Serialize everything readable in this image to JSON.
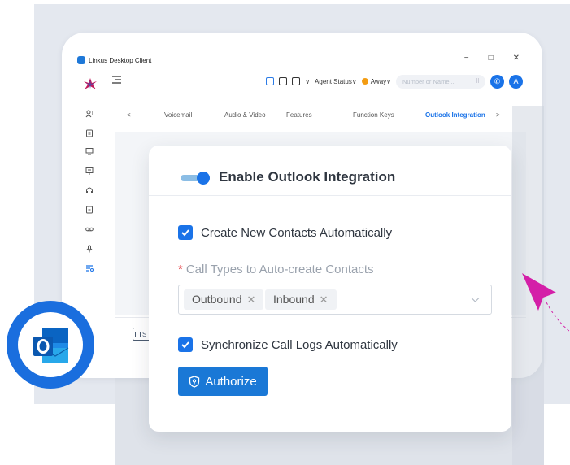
{
  "window": {
    "title": "Linkus Desktop Client",
    "controls": [
      "−",
      "□",
      "✕"
    ]
  },
  "toolbar": {
    "agent_status": "Agent Status",
    "presence": "Away",
    "search_placeholder": "Number or Name...",
    "avatar_letter": "A"
  },
  "tabs": [
    "Voicemail",
    "Audio & Video",
    "Features",
    "Function Keys",
    "Outlook Integration"
  ],
  "active_tab": "Outlook Integration",
  "save_label": "S",
  "card": {
    "title": "Enable Outlook Integration",
    "create_contacts_label": "Create New Contacts Automatically",
    "call_types_label": "Call Types to Auto-create Contacts",
    "required_mark": "*",
    "chips": [
      "Outbound",
      "Inbound"
    ],
    "sync_logs_label": "Synchronize Call Logs Automatically",
    "authorize_label": "Authorize"
  },
  "colors": {
    "accent": "#1a73e8",
    "required": "#e5484d",
    "arrow": "#d41fa8"
  }
}
